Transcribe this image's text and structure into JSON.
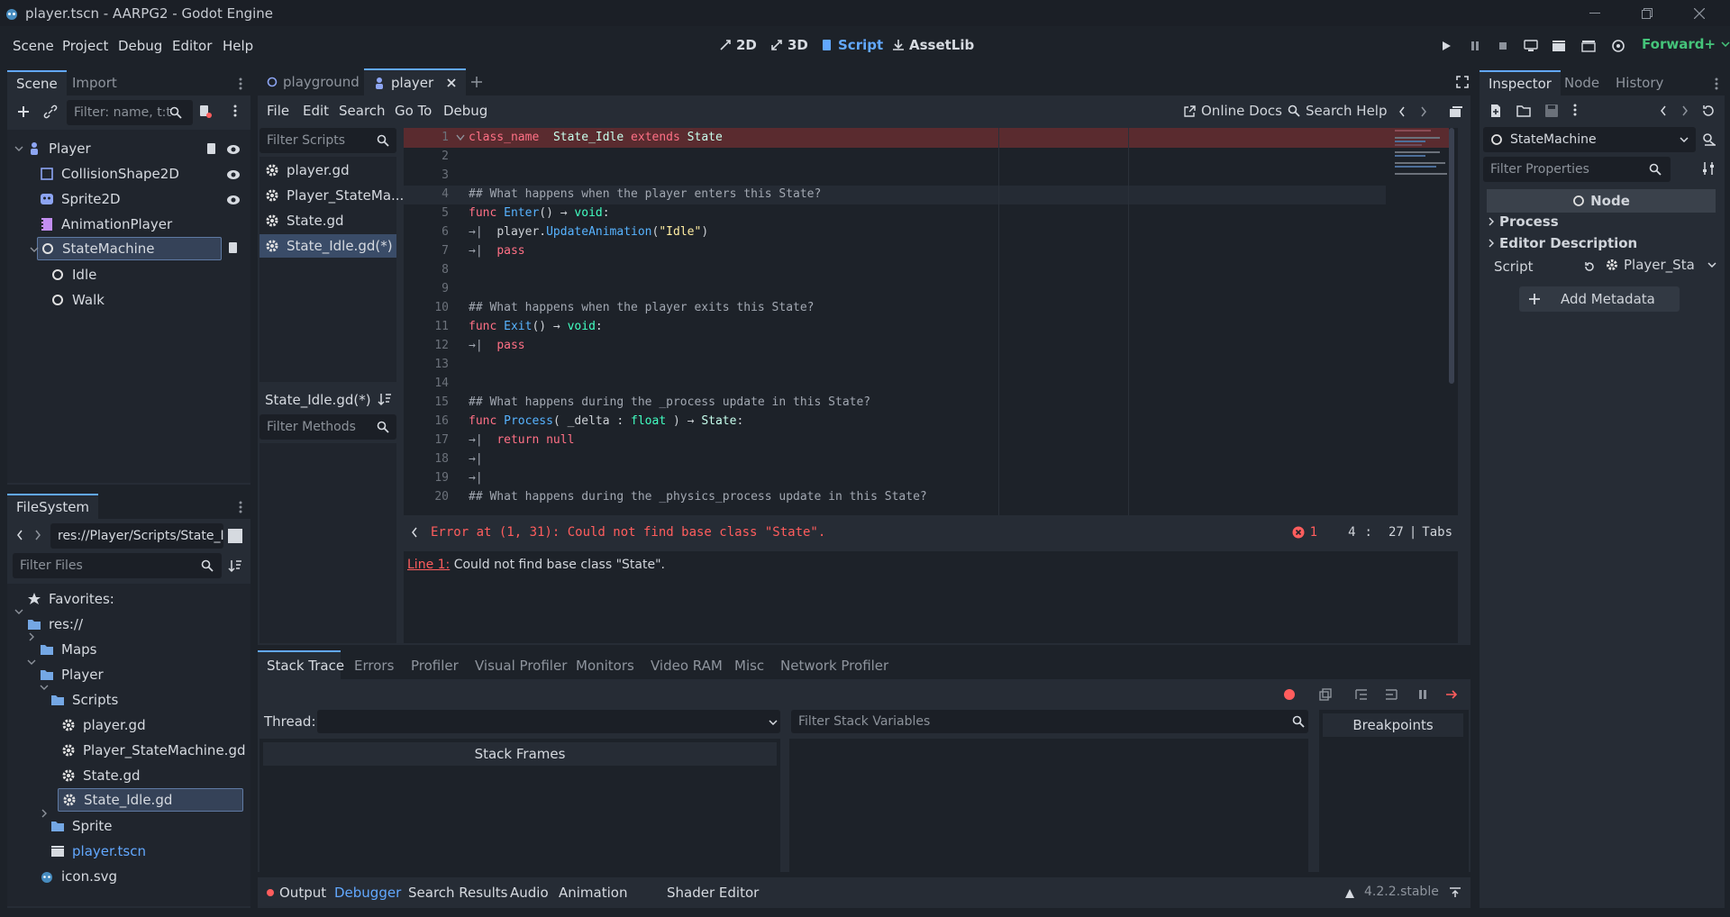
{
  "window": {
    "title": "player.tscn - AARPG2 - Godot Engine"
  },
  "menus": [
    "Scene",
    "Project",
    "Debug",
    "Editor",
    "Help"
  ],
  "workspaces": [
    {
      "label": "2D",
      "icon": "2d-icon"
    },
    {
      "label": "3D",
      "icon": "3d-icon"
    },
    {
      "label": "Script",
      "icon": "script-icon",
      "active": true
    },
    {
      "label": "AssetLib",
      "icon": "assetlib-icon"
    }
  ],
  "renderer": "Forward+",
  "scene_dock": {
    "tabs": [
      "Scene",
      "Import"
    ],
    "filter_placeholder": "Filter: name, t:t",
    "tree": [
      {
        "label": "Player",
        "icon": "character-body-icon"
      },
      {
        "label": "CollisionShape2D",
        "icon": "collision-shape-icon"
      },
      {
        "label": "Sprite2D",
        "icon": "sprite-icon"
      },
      {
        "label": "AnimationPlayer",
        "icon": "animation-player-icon"
      },
      {
        "label": "StateMachine",
        "icon": "node-icon"
      },
      {
        "label": "Idle",
        "icon": "node-icon"
      },
      {
        "label": "Walk",
        "icon": "node-icon"
      }
    ]
  },
  "filesystem": {
    "tab": "FileSystem",
    "path": "res://Player/Scripts/State_I",
    "filter_placeholder": "Filter Files",
    "tree": [
      {
        "label": "Favorites:",
        "icon": "star-icon"
      },
      {
        "label": "res://",
        "icon": "folder-icon"
      },
      {
        "label": "Maps",
        "icon": "folder-icon"
      },
      {
        "label": "Player",
        "icon": "folder-icon"
      },
      {
        "label": "Scripts",
        "icon": "folder-icon"
      },
      {
        "label": "player.gd",
        "icon": "gear-icon"
      },
      {
        "label": "Player_StateMachine.gd",
        "icon": "gear-icon"
      },
      {
        "label": "State.gd",
        "icon": "gear-icon"
      },
      {
        "label": "State_Idle.gd",
        "icon": "gear-icon"
      },
      {
        "label": "Sprite",
        "icon": "folder-icon"
      },
      {
        "label": "player.tscn",
        "icon": "scene-icon"
      },
      {
        "label": "icon.svg",
        "icon": "image-icon"
      }
    ]
  },
  "editor_tabs": [
    "playground",
    "player"
  ],
  "script_menu": [
    "File",
    "Edit",
    "Search",
    "Go To",
    "Debug"
  ],
  "script_toolbar": {
    "online_docs": "Online Docs",
    "search_help": "Search Help"
  },
  "script_list": {
    "filter_placeholder": "Filter Scripts",
    "items": [
      "player.gd",
      "Player_StateMa...",
      "State.gd",
      "State_Idle.gd(*)"
    ],
    "current": "State_Idle.gd(*)",
    "methods_placeholder": "Filter Methods"
  },
  "code": {
    "lines": [
      {
        "n": "1",
        "tokens": [
          [
            "kw",
            "class_name"
          ],
          [
            "",
            "  "
          ],
          [
            "cl",
            "State_Idle"
          ],
          [
            "",
            " "
          ],
          [
            "kw",
            "extends"
          ],
          [
            "",
            " "
          ],
          [
            "cl",
            "State"
          ]
        ]
      },
      {
        "n": "2",
        "tokens": []
      },
      {
        "n": "3",
        "tokens": []
      },
      {
        "n": "4",
        "tokens": [
          [
            "cm",
            "## What happens when the player enters this State?"
          ]
        ]
      },
      {
        "n": "5",
        "tokens": [
          [
            "kw",
            "func"
          ],
          [
            "",
            " "
          ],
          [
            "fn",
            "Enter"
          ],
          [
            "",
            "() → "
          ],
          [
            "ty",
            "void"
          ],
          [
            "",
            ":"
          ]
        ]
      },
      {
        "n": "6",
        "tokens": [
          [
            "cm",
            "→|  "
          ],
          [
            "",
            "player."
          ],
          [
            "fn",
            "UpdateAnimation"
          ],
          [
            "",
            "("
          ],
          [
            "st",
            "\"Idle\""
          ],
          [
            "",
            ")"
          ]
        ]
      },
      {
        "n": "7",
        "tokens": [
          [
            "cm",
            "→|  "
          ],
          [
            "kw",
            "pass"
          ]
        ]
      },
      {
        "n": "8",
        "tokens": []
      },
      {
        "n": "9",
        "tokens": []
      },
      {
        "n": "10",
        "tokens": [
          [
            "cm",
            "## What happens when the player exits this State?"
          ]
        ]
      },
      {
        "n": "11",
        "tokens": [
          [
            "kw",
            "func"
          ],
          [
            "",
            " "
          ],
          [
            "fn",
            "Exit"
          ],
          [
            "",
            "() → "
          ],
          [
            "ty",
            "void"
          ],
          [
            "",
            ":"
          ]
        ]
      },
      {
        "n": "12",
        "tokens": [
          [
            "cm",
            "→|  "
          ],
          [
            "kw",
            "pass"
          ]
        ]
      },
      {
        "n": "13",
        "tokens": []
      },
      {
        "n": "14",
        "tokens": []
      },
      {
        "n": "15",
        "tokens": [
          [
            "cm",
            "## What happens during the _process update in this State?"
          ]
        ]
      },
      {
        "n": "16",
        "tokens": [
          [
            "kw",
            "func"
          ],
          [
            "",
            " "
          ],
          [
            "fn",
            "Process"
          ],
          [
            "",
            "( _delta : "
          ],
          [
            "ty",
            "float"
          ],
          [
            "",
            " ) → "
          ],
          [
            "cl",
            "State"
          ],
          [
            "",
            ":"
          ]
        ]
      },
      {
        "n": "17",
        "tokens": [
          [
            "cm",
            "→|  "
          ],
          [
            "kw",
            "return"
          ],
          [
            "",
            " "
          ],
          [
            "kw",
            "null"
          ]
        ]
      },
      {
        "n": "18",
        "tokens": [
          [
            "cm",
            "→|"
          ]
        ]
      },
      {
        "n": "19",
        "tokens": [
          [
            "cm",
            "→|"
          ]
        ]
      },
      {
        "n": "20",
        "tokens": [
          [
            "cm",
            "## What happens during the _physics_process update in this State?"
          ]
        ]
      }
    ]
  },
  "status": {
    "error": "Error at (1, 31): Could not find base class \"State\".",
    "error_count": "1",
    "line": "4",
    "col": "27",
    "indent": "Tabs"
  },
  "error_panel": {
    "link": "Line 1:",
    "message": " Could not find base class \"State\"."
  },
  "debugger": {
    "tabs": [
      "Stack Trace",
      "Errors",
      "Profiler",
      "Visual Profiler",
      "Monitors",
      "Video RAM",
      "Misc",
      "Network Profiler"
    ],
    "thread_label": "Thread:",
    "stack_vars_placeholder": "Filter Stack Variables",
    "stack_frames": "Stack Frames",
    "breakpoints": "Breakpoints"
  },
  "bottom_tabs": [
    "Output",
    "Debugger",
    "Search Results",
    "Audio",
    "Animation",
    "Shader Editor"
  ],
  "version": "4.2.2.stable",
  "inspector": {
    "tabs": [
      "Inspector",
      "Node",
      "History"
    ],
    "object": "StateMachine",
    "filter_placeholder": "Filter Properties",
    "section": "Node",
    "groups": [
      "Process",
      "Editor Description"
    ],
    "script_label": "Script",
    "script_value": "Player_Sta",
    "add_metadata": "Add Metadata"
  },
  "colors": {
    "accent": "#62a8ff",
    "error": "#ff5d5d",
    "keyword": "#ff7085",
    "type": "#42ffc2",
    "function": "#57b3ff",
    "string": "#ffeda1"
  }
}
